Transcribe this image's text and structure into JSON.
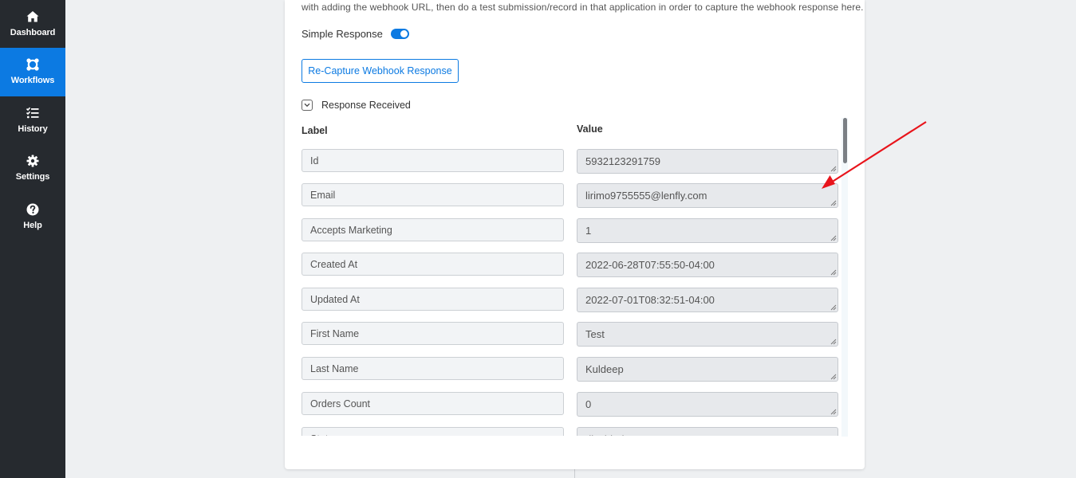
{
  "sidebar": {
    "items": [
      {
        "label": "Dashboard",
        "icon": "home-icon",
        "active": false
      },
      {
        "label": "Workflows",
        "icon": "workflow-icon",
        "active": true
      },
      {
        "label": "History",
        "icon": "history-list-icon",
        "active": false
      },
      {
        "label": "Settings",
        "icon": "gear-icon",
        "active": false
      },
      {
        "label": "Help",
        "icon": "help-circle-icon",
        "active": false
      }
    ]
  },
  "webhook": {
    "intro_text": "with adding the webhook URL, then do a test submission/record in that application in order to capture the webhook response here.",
    "simple_response_label": "Simple Response",
    "simple_response_enabled": true,
    "recapture_label": "Re-Capture Webhook Response",
    "response_received_label": "Response Received",
    "label_header": "Label",
    "value_header": "Value",
    "rows": [
      {
        "label": "Id",
        "value": "5932123291759"
      },
      {
        "label": "Email",
        "value": "lirimo9755555@lenfly.com"
      },
      {
        "label": "Accepts Marketing",
        "value": "1"
      },
      {
        "label": "Created At",
        "value": "2022-06-28T07:55:50-04:00"
      },
      {
        "label": "Updated At",
        "value": "2022-07-01T08:32:51-04:00"
      },
      {
        "label": "First Name",
        "value": "Test"
      },
      {
        "label": "Last Name",
        "value": "Kuldeep"
      },
      {
        "label": "Orders Count",
        "value": "0"
      },
      {
        "label": "State",
        "value": "disabled"
      }
    ]
  },
  "colors": {
    "sidebar_bg": "#262a2f",
    "accent": "#0c7ae2",
    "annotation_arrow": "#e8141b"
  }
}
